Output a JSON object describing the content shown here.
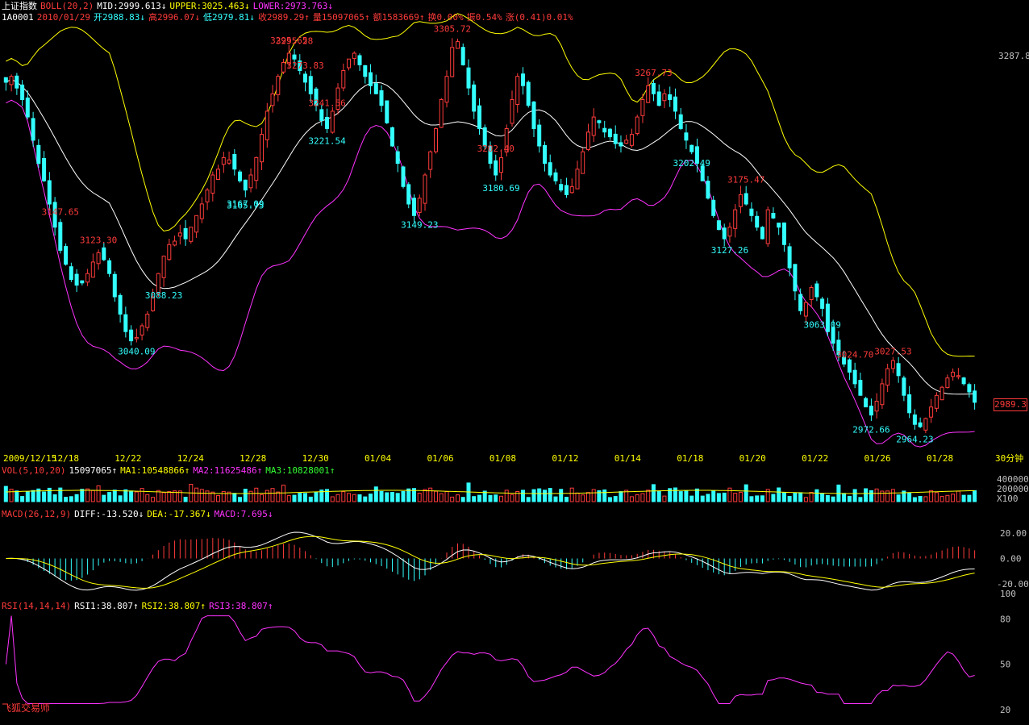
{
  "header": {
    "index_name": "上证指数",
    "boll_label": "BOLL(20,2)",
    "mid": "MID:2999.613↓",
    "upper": "UPPER:3025.463↓",
    "lower": "LOWER:2973.763↓",
    "code": "1A0001",
    "date": "2010/01/29",
    "open": "开2988.83↓",
    "high": "高2996.07↓",
    "low": "低2979.81↓",
    "close": "收2989.29↑",
    "volume": "量15097065↑",
    "amount": "额1583669↑",
    "turnover": "换0.00%",
    "amplitude": "振0.54%",
    "change": "涨(0.41)0.01%"
  },
  "volume_header": {
    "label": "VOL(5,10,20)",
    "value": "15097065↑",
    "ma1": "MA1:10548866↑",
    "ma2": "MA2:11625486↑",
    "ma3": "MA3:10828001↑"
  },
  "macd_header": {
    "label": "MACD(26,12,9)",
    "diff": "DIFF:-13.520↓",
    "dea": "DEA:-17.367↓",
    "macd": "MACD:7.695↓"
  },
  "rsi_header": {
    "label": "RSI(14,14,14)",
    "rsi1": "RSI1:38.807↑",
    "rsi2": "RSI2:38.807↑",
    "rsi3": "RSI3:38.807↑"
  },
  "brand": "飞狐交易师",
  "current_price": "2989.3",
  "period_label": "30分钟",
  "colors": {
    "up": "#ff3b3b",
    "down": "#33ffff",
    "upper": "#ffff00",
    "mid": "#ffffff",
    "lower": "#ff33ff",
    "rsi": "#ff33ff"
  },
  "chart_data": [
    {
      "type": "candlestick",
      "period": "30分钟",
      "ylim": [
        2950,
        3315
      ],
      "x_tick_labels": [
        "2009/12/15",
        "12/18",
        "12/22",
        "12/24",
        "12/28",
        "12/30",
        "01/04",
        "01/06",
        "01/08",
        "01/12",
        "01/14",
        "01/18",
        "01/20",
        "01/22",
        "01/26",
        "01/28"
      ],
      "y_tick_labels": [
        3287.8
      ],
      "close_path": [
        3265,
        3270,
        3260,
        3250,
        3235,
        3215,
        3195,
        3180,
        3160,
        3140,
        3120,
        3108,
        3095,
        3090,
        3092,
        3100,
        3110,
        3118,
        3112,
        3100,
        3080,
        3065,
        3050,
        3042,
        3045,
        3055,
        3065,
        3080,
        3100,
        3115,
        3125,
        3128,
        3135,
        3130,
        3140,
        3150,
        3160,
        3172,
        3185,
        3190,
        3200,
        3198,
        3190,
        3180,
        3172,
        3185,
        3200,
        3220,
        3240,
        3255,
        3270,
        3282,
        3290,
        3285,
        3275,
        3265,
        3255,
        3245,
        3232,
        3225,
        3240,
        3260,
        3275,
        3285,
        3290,
        3280,
        3270,
        3262,
        3255,
        3245,
        3230,
        3210,
        3195,
        3175,
        3160,
        3150,
        3165,
        3185,
        3205,
        3225,
        3250,
        3270,
        3295,
        3300,
        3280,
        3260,
        3240,
        3225,
        3210,
        3195,
        3185,
        3200,
        3225,
        3250,
        3270,
        3262,
        3245,
        3225,
        3210,
        3195,
        3185,
        3180,
        3172,
        3168,
        3175,
        3190,
        3205,
        3222,
        3235,
        3230,
        3222,
        3218,
        3212,
        3210,
        3215,
        3220,
        3235,
        3250,
        3262,
        3255,
        3245,
        3255,
        3250,
        3240,
        3225,
        3215,
        3205,
        3195,
        3180,
        3165,
        3150,
        3138,
        3130,
        3140,
        3155,
        3168,
        3160,
        3150,
        3140,
        3130,
        3155,
        3148,
        3140,
        3125,
        3105,
        3085,
        3068,
        3075,
        3088,
        3080,
        3070,
        3050,
        3040,
        3030,
        3022,
        3015,
        3005,
        2995,
        2985,
        2978,
        2990,
        3005,
        3018,
        3025,
        3012,
        2995,
        2980,
        2970,
        2968,
        2975,
        2985,
        2995,
        3002,
        3010,
        3015,
        3012,
        3005,
        2998,
        2989
      ],
      "labels_high": [
        3123.3,
        3202.4,
        3295.28,
        3295.65,
        3305.72,
        3273.83,
        3241.56,
        3267.73,
        3175.47,
        3147.65,
        3027.53,
        3024.7
      ],
      "labels_low": [
        3088.23,
        3040.09,
        3167.09,
        3221.54,
        3149.23,
        3180.69,
        3165.75,
        3202.49,
        3127.26,
        3063.09,
        2972.66,
        2964.23
      ],
      "series": [
        {
          "name": "MID"
        },
        {
          "name": "UPPER"
        },
        {
          "name": "LOWER"
        }
      ]
    },
    {
      "type": "bar",
      "y_tick_labels": [
        "400000",
        "200000",
        "X100"
      ],
      "series": [
        {
          "name": "MA1"
        },
        {
          "name": "MA2"
        },
        {
          "name": "MA3"
        }
      ]
    },
    {
      "type": "line",
      "y_tick_labels": [
        "20.00",
        "0.00",
        "-20.00",
        "100"
      ],
      "ylim": [
        -30,
        30
      ],
      "series": [
        {
          "name": "DIFF"
        },
        {
          "name": "DEA"
        },
        {
          "name": "MACD"
        }
      ]
    },
    {
      "type": "line",
      "y_tick_labels": [
        "80",
        "50",
        "20"
      ],
      "ylim": [
        20,
        85
      ],
      "series": [
        {
          "name": "RSI1"
        }
      ]
    }
  ]
}
